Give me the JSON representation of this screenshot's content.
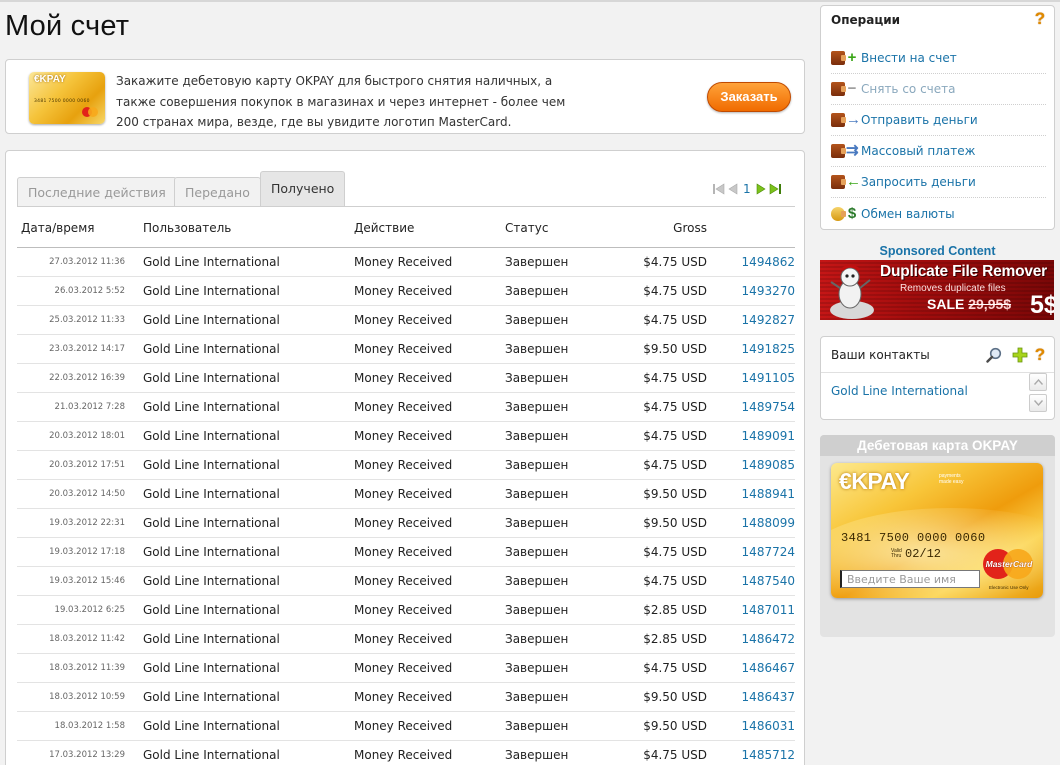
{
  "page": {
    "title": "Мой счет"
  },
  "promo": {
    "card_brand": "€KPAY",
    "card_number": "3481 7500 0000 0060",
    "text": "Закажите дебетовую карту OKPAY для быстрого снятия наличных, а также совершения покупок в магазинах и через интернет - более чем 200 странах мира, везде, где вы увидите логотип MasterCard.",
    "button_label": "Заказать",
    "button_color": "#f07a10"
  },
  "tabs": [
    {
      "label": "Последние действия",
      "active": false
    },
    {
      "label": "Передано",
      "active": false
    },
    {
      "label": "Получено",
      "active": true
    }
  ],
  "pager": {
    "current_page": "1"
  },
  "table": {
    "headers": {
      "date": "Дата/время",
      "user": "Пользователь",
      "action": "Действие",
      "status": "Статус",
      "gross": "Gross",
      "id": ""
    },
    "rows": [
      {
        "date": "27.03.2012 11:36",
        "user": "Gold Line International",
        "action": "Money Received",
        "status": "Завершен",
        "gross": "$4.75 USD",
        "id": "1494862"
      },
      {
        "date": "26.03.2012 5:52",
        "user": "Gold Line International",
        "action": "Money Received",
        "status": "Завершен",
        "gross": "$4.75 USD",
        "id": "1493270"
      },
      {
        "date": "25.03.2012 11:33",
        "user": "Gold Line International",
        "action": "Money Received",
        "status": "Завершен",
        "gross": "$4.75 USD",
        "id": "1492827"
      },
      {
        "date": "23.03.2012 14:17",
        "user": "Gold Line International",
        "action": "Money Received",
        "status": "Завершен",
        "gross": "$9.50 USD",
        "id": "1491825"
      },
      {
        "date": "22.03.2012 16:39",
        "user": "Gold Line International",
        "action": "Money Received",
        "status": "Завершен",
        "gross": "$4.75 USD",
        "id": "1491105"
      },
      {
        "date": "21.03.2012 7:28",
        "user": "Gold Line International",
        "action": "Money Received",
        "status": "Завершен",
        "gross": "$4.75 USD",
        "id": "1489754"
      },
      {
        "date": "20.03.2012 18:01",
        "user": "Gold Line International",
        "action": "Money Received",
        "status": "Завершен",
        "gross": "$4.75 USD",
        "id": "1489091"
      },
      {
        "date": "20.03.2012 17:51",
        "user": "Gold Line International",
        "action": "Money Received",
        "status": "Завершен",
        "gross": "$4.75 USD",
        "id": "1489085"
      },
      {
        "date": "20.03.2012 14:50",
        "user": "Gold Line International",
        "action": "Money Received",
        "status": "Завершен",
        "gross": "$9.50 USD",
        "id": "1488941"
      },
      {
        "date": "19.03.2012 22:31",
        "user": "Gold Line International",
        "action": "Money Received",
        "status": "Завершен",
        "gross": "$9.50 USD",
        "id": "1488099"
      },
      {
        "date": "19.03.2012 17:18",
        "user": "Gold Line International",
        "action": "Money Received",
        "status": "Завершен",
        "gross": "$4.75 USD",
        "id": "1487724"
      },
      {
        "date": "19.03.2012 15:46",
        "user": "Gold Line International",
        "action": "Money Received",
        "status": "Завершен",
        "gross": "$4.75 USD",
        "id": "1487540"
      },
      {
        "date": "19.03.2012 6:25",
        "user": "Gold Line International",
        "action": "Money Received",
        "status": "Завершен",
        "gross": "$2.85 USD",
        "id": "1487011"
      },
      {
        "date": "18.03.2012 11:42",
        "user": "Gold Line International",
        "action": "Money Received",
        "status": "Завершен",
        "gross": "$2.85 USD",
        "id": "1486472"
      },
      {
        "date": "18.03.2012 11:39",
        "user": "Gold Line International",
        "action": "Money Received",
        "status": "Завершен",
        "gross": "$4.75 USD",
        "id": "1486467"
      },
      {
        "date": "18.03.2012 10:59",
        "user": "Gold Line International",
        "action": "Money Received",
        "status": "Завершен",
        "gross": "$9.50 USD",
        "id": "1486437"
      },
      {
        "date": "18.03.2012 1:58",
        "user": "Gold Line International",
        "action": "Money Received",
        "status": "Завершен",
        "gross": "$9.50 USD",
        "id": "1486031"
      },
      {
        "date": "17.03.2012 13:29",
        "user": "Gold Line International",
        "action": "Money Received",
        "status": "Завершен",
        "gross": "$4.75 USD",
        "id": "1485712"
      }
    ]
  },
  "operations": {
    "title": "Операции",
    "items": [
      {
        "label": "Внести на счет",
        "icon": "wallet-plus-icon",
        "mark": "+",
        "mark_color": "#3aa617",
        "disabled": false
      },
      {
        "label": "Снять со счета",
        "icon": "wallet-minus-icon",
        "mark": "−",
        "mark_color": "#9a9a9a",
        "disabled": true
      },
      {
        "label": "Отправить деньги",
        "icon": "wallet-send-icon",
        "mark": "→",
        "mark_color": "#4a7ac0",
        "disabled": false
      },
      {
        "label": "Массовый платеж",
        "icon": "wallet-mass-icon",
        "mark": "⇉",
        "mark_color": "#4a7ac0",
        "disabled": false
      },
      {
        "label": "Запросить деньги",
        "icon": "wallet-request-icon",
        "mark": "←",
        "mark_color": "#3aa617",
        "disabled": false
      },
      {
        "label": "Обмен валюты",
        "icon": "currency-exchange-icon",
        "mark": "$",
        "mark_color": "#2b7a2b",
        "disabled": false
      }
    ]
  },
  "sponsored": {
    "label": "Sponsored Content",
    "ad_title": "Duplicate File Remover",
    "ad_subtitle": "Removes duplicate files",
    "ad_sale": "SALE",
    "ad_old_price": "29,95$",
    "ad_new_price": "5$"
  },
  "contacts": {
    "title": "Ваши контакты",
    "items": [
      "Gold Line International"
    ]
  },
  "debit_card": {
    "title": "Дебетовая карта OKPAY",
    "brand": "€KPAY",
    "tagline_1": "payments",
    "tagline_2": "made easy",
    "number": "3481 7500 0000 0060",
    "valid_label_1": "Valid",
    "valid_label_2": "Thru",
    "expiry": "02/12",
    "name_placeholder": "Введите Ваше имя",
    "network": "MasterCard",
    "usage_note": "Electronic Use Only"
  },
  "colors": {
    "link": "#1a73a8",
    "accent_orange": "#f07a10",
    "ad_red": "#a30d0d"
  }
}
